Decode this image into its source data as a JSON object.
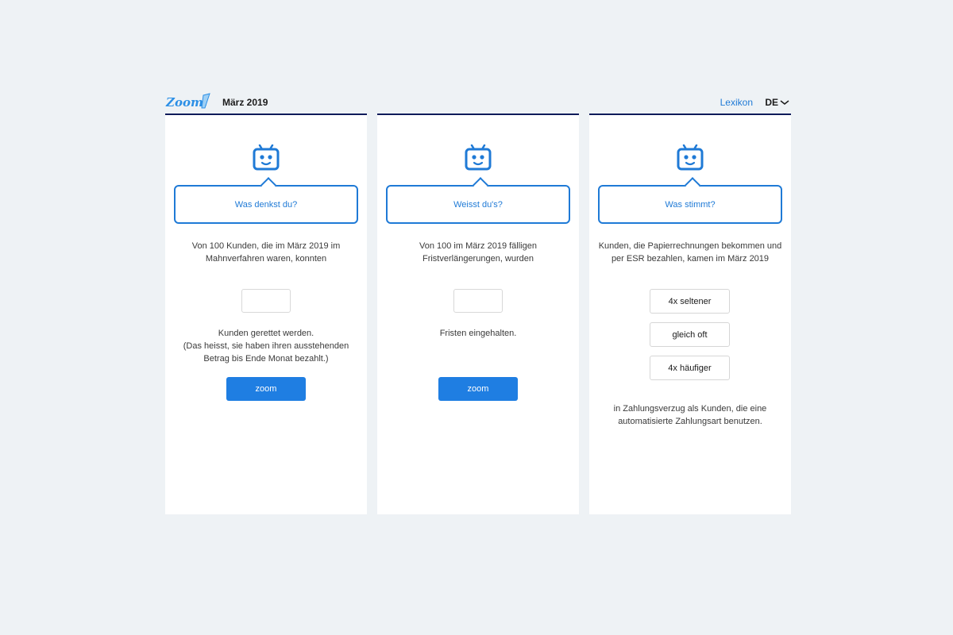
{
  "header": {
    "logo_text": "Zoom!",
    "title": "März 2019",
    "lexikon": "Lexikon",
    "language": "DE"
  },
  "colors": {
    "accent": "#1f7ad6",
    "button": "#1f7ee2",
    "topbar": "#0d1b5a",
    "background": "#eef2f5"
  },
  "cards": [
    {
      "robot_icon": "robot-icon",
      "bubble": "Was denkst du?",
      "prompt": "Von 100 Kunden, die im März 2019 im\nMahnverfahren waren, konnten",
      "input_value": "",
      "after": "Kunden gerettet werden.\n(Das heisst, sie haben ihren ausstehenden\nBetrag bis Ende Monat bezahlt.)",
      "button": "zoom"
    },
    {
      "robot_icon": "robot-icon",
      "bubble": "Weisst du's?",
      "prompt": "Von 100 im März 2019 fälligen\nFristverlängerungen, wurden",
      "input_value": "",
      "after": "Fristen eingehalten.",
      "button": "zoom"
    },
    {
      "robot_icon": "robot-icon",
      "bubble": "Was stimmt?",
      "prompt": "Kunden, die Papierrechnungen bekommen und\nper ESR bezahlen, kamen im März 2019",
      "options": [
        "4x seltener",
        "gleich oft",
        "4x häufiger"
      ],
      "after": "in Zahlungsverzug als Kunden, die eine\nautomatisierte Zahlungsart benutzen."
    }
  ]
}
